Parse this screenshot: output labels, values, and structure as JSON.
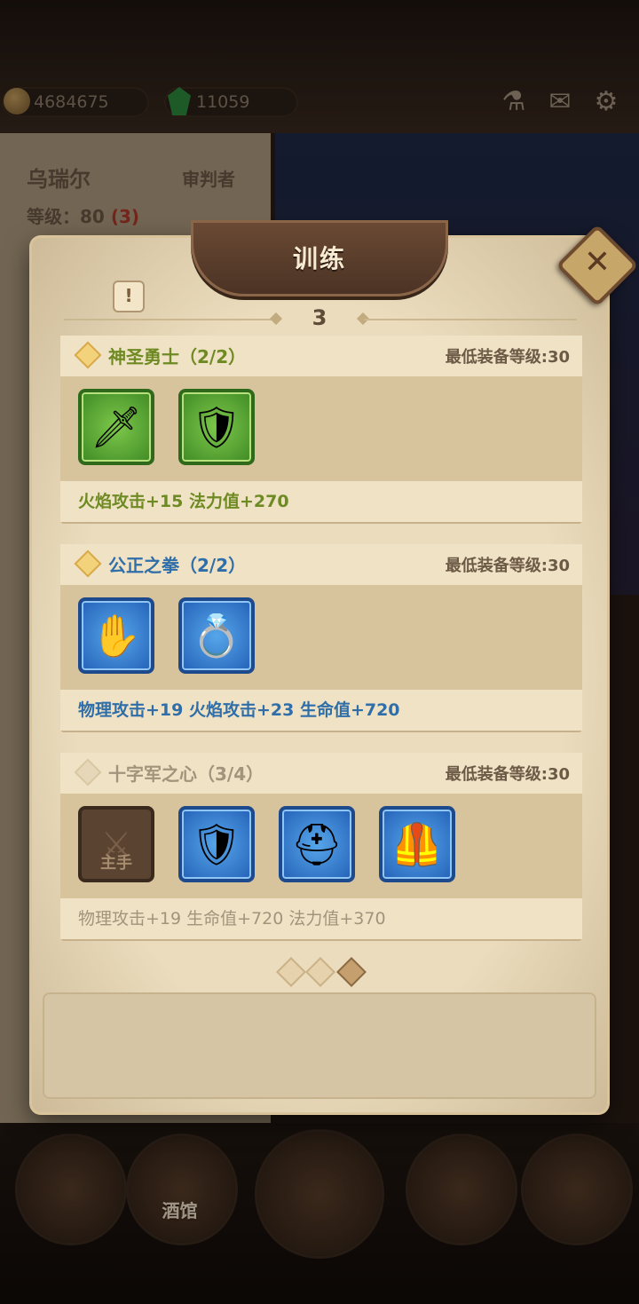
{
  "hud": {
    "gold": "4684675",
    "gems": "11059"
  },
  "hero": {
    "name": "乌瑞尔",
    "class": "审判者",
    "level_label": "等级：",
    "level": "80",
    "level_bonus": "(3)"
  },
  "bottom_nav": {
    "tavern_label": "酒馆"
  },
  "dialog": {
    "title": "训练",
    "page_number": "3",
    "close_symbol": "✕",
    "info_symbol": "!"
  },
  "sets": [
    {
      "name": "神圣勇士（2/2）",
      "requirement": "最低装备等级:30",
      "bonus": "火焰攻击+15  法力值+270",
      "active": true,
      "name_color": "#6e8a23",
      "items": [
        {
          "icon": "sword-icon",
          "rarity": "green"
        },
        {
          "icon": "round-shield-icon",
          "rarity": "green"
        }
      ]
    },
    {
      "name": "公正之拳（2/2）",
      "requirement": "最低装备等级:30",
      "bonus": "物理攻击+19  火焰攻击+23  生命值+720",
      "active": true,
      "name_color": "#2f6ea8",
      "items": [
        {
          "icon": "gauntlet-icon",
          "rarity": "blue"
        },
        {
          "icon": "eye-ring-icon",
          "rarity": "blue"
        }
      ]
    },
    {
      "name": "十字军之心（3/4）",
      "requirement": "最低装备等级:30",
      "bonus": "物理攻击+19  生命值+720  法力值+370",
      "active": false,
      "name_color": "#a3927c",
      "items": [
        {
          "icon": "empty-slot-icon",
          "rarity": "empty",
          "slot_label": "主手"
        },
        {
          "icon": "kite-shield-icon",
          "rarity": "blue"
        },
        {
          "icon": "helmet-icon",
          "rarity": "blue"
        },
        {
          "icon": "chest-armor-icon",
          "rarity": "blue"
        }
      ]
    }
  ],
  "pager": {
    "total": 3,
    "active_index": 2
  },
  "colors": {
    "active_bonus_set1": "#6e8a23",
    "active_bonus_set2": "#2f6ea8",
    "inactive_text": "#a3927c",
    "parchment": "#eadcbd"
  }
}
